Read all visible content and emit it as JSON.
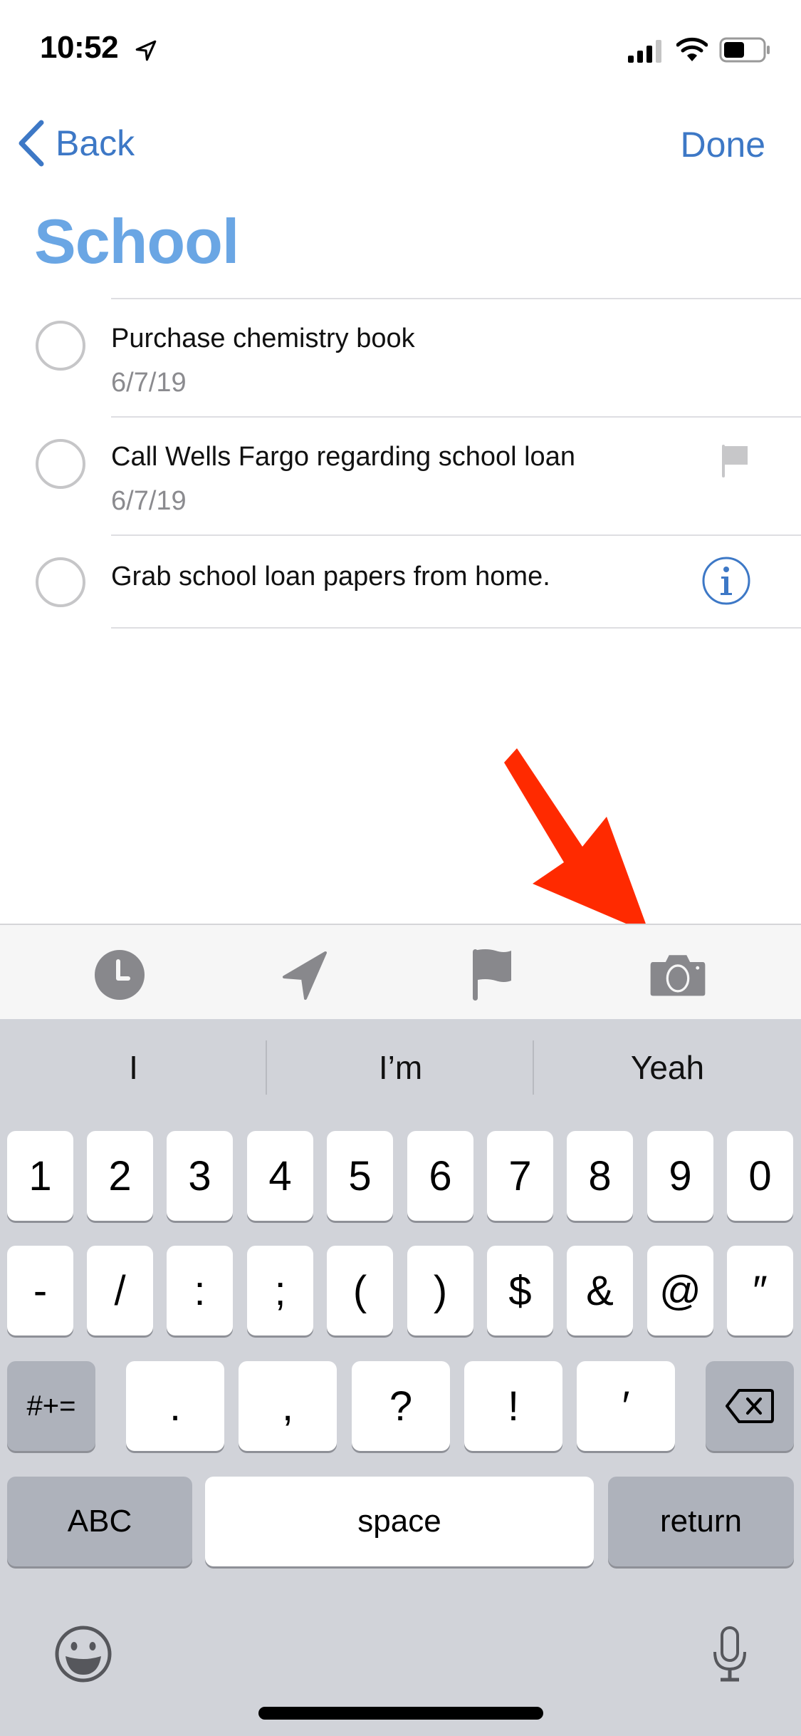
{
  "status_bar": {
    "time": "10:52",
    "location_icon": "location-arrow-icon",
    "signal_icon": "cellular-signal-icon",
    "wifi_icon": "wifi-icon",
    "battery_icon": "battery-icon"
  },
  "nav": {
    "back_label": "Back",
    "done_label": "Done"
  },
  "list": {
    "title": "School",
    "items": [
      {
        "task": "Purchase chemistry book",
        "date": "6/7/19",
        "flagged": false,
        "show_info": false
      },
      {
        "task": "Call Wells Fargo regarding school loan",
        "date": "6/7/19",
        "flagged": true,
        "show_info": false
      },
      {
        "task": "Grab school loan papers from home.",
        "date": "",
        "flagged": false,
        "show_info": true
      }
    ]
  },
  "toolbar": {
    "items": [
      "clock-icon",
      "location-icon",
      "flag-icon",
      "camera-icon"
    ]
  },
  "annotation": {
    "arrow_color": "#ff2a00",
    "target": "camera-icon"
  },
  "keyboard": {
    "suggestions": [
      "I",
      "I’m",
      "Yeah"
    ],
    "row1": [
      "1",
      "2",
      "3",
      "4",
      "5",
      "6",
      "7",
      "8",
      "9",
      "0"
    ],
    "row2": [
      "-",
      "/",
      ":",
      ";",
      "(",
      ")",
      "$",
      "&",
      "@",
      "″"
    ],
    "row3_left": "#+=",
    "row3": [
      ".",
      ",",
      "?",
      "!",
      "′"
    ],
    "row3_right_icon": "delete-icon",
    "abc_label": "ABC",
    "space_label": "space",
    "return_label": "return",
    "emoji_icon": "emoji-icon",
    "mic_icon": "microphone-icon"
  },
  "colors": {
    "accent": "#3d78c6",
    "title": "#6aa6e4",
    "toolbar_icon": "#88888c",
    "keyboard_bg": "#d1d3d9"
  }
}
